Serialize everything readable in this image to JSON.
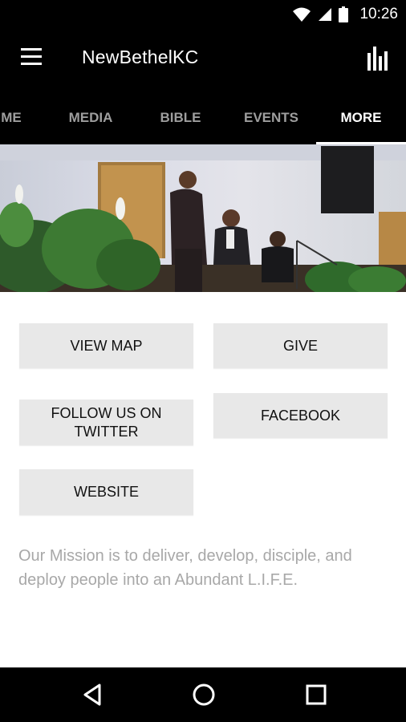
{
  "status_bar": {
    "time": "10:26"
  },
  "app_bar": {
    "title": "NewBethelKC"
  },
  "tabs": [
    {
      "label": "ME"
    },
    {
      "label": "MEDIA"
    },
    {
      "label": "BIBLE"
    },
    {
      "label": "EVENTS"
    },
    {
      "label": "MORE",
      "active": true
    }
  ],
  "buttons": {
    "view_map": "VIEW MAP",
    "give": "GIVE",
    "follow_twitter": "FOLLOW US ON TWITTER",
    "facebook": "FACEBOOK",
    "website": "WEBSITE"
  },
  "mission_text": "Our Mission is to deliver, develop, disciple, and deploy people into an Abundant L.I.F.E.",
  "icons": {
    "menu": "hamburger-menu-icon",
    "stats": "bar-chart-icon",
    "wifi": "wifi-icon",
    "signal": "cell-signal-icon",
    "battery": "battery-icon",
    "back": "back-triangle-icon",
    "home": "home-circle-icon",
    "recents": "recents-square-icon"
  },
  "colors": {
    "bar_background": "#000000",
    "button_background": "#e8e8e8",
    "mission_text": "#a8a8a8",
    "inactive_tab": "#9e9e9e"
  }
}
